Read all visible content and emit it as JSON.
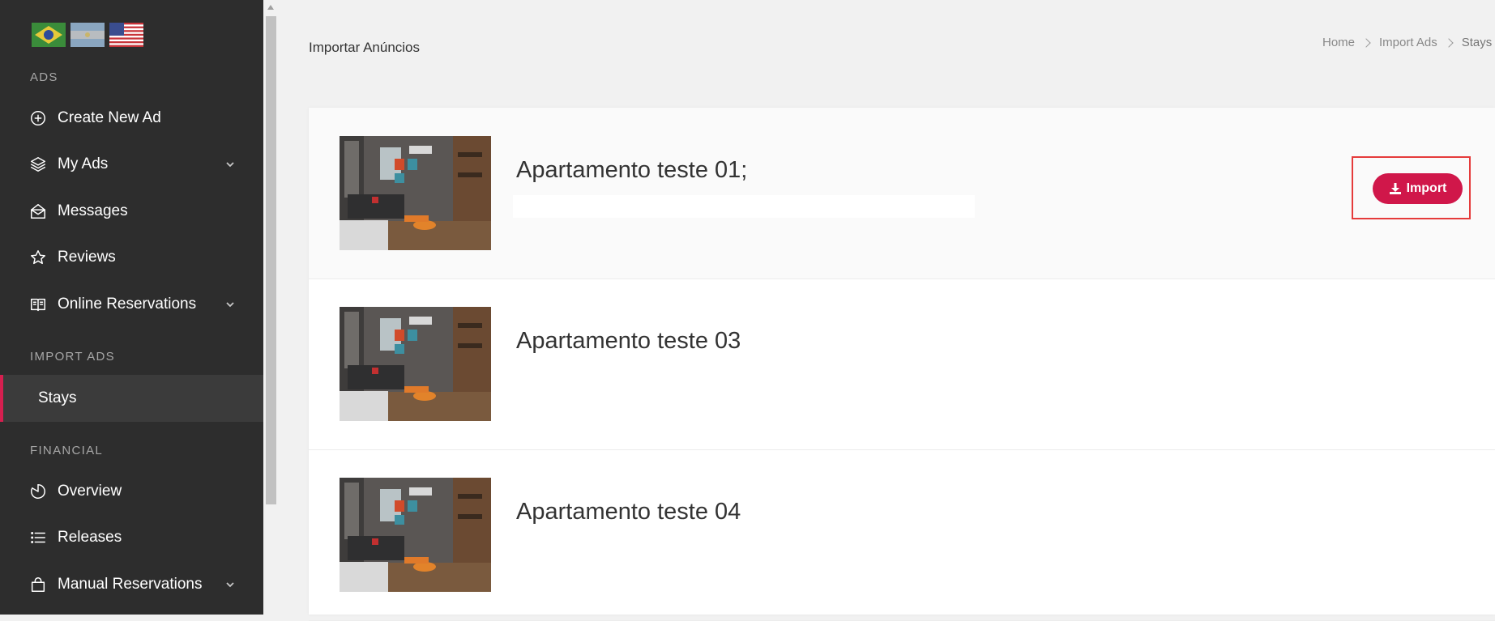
{
  "sidebar": {
    "flags": [
      "brazil-flag",
      "argentina-flag",
      "usa-flag"
    ],
    "sections": {
      "ads": "ADS",
      "import_ads": "IMPORT ADS",
      "financial": "FINANCIAL"
    },
    "items": {
      "create_new_ad": "Create New Ad",
      "my_ads": "My Ads",
      "messages": "Messages",
      "reviews": "Reviews",
      "online_reservations": "Online Reservations",
      "stays": "Stays",
      "overview": "Overview",
      "releases": "Releases",
      "manual_reservations": "Manual Reservations"
    }
  },
  "header": {
    "title": "Importar Anúncios",
    "breadcrumb": [
      "Home",
      "Import Ads",
      "Stays"
    ]
  },
  "listings": [
    {
      "title": "Apartamento teste 01;"
    },
    {
      "title": "Apartamento teste 03"
    },
    {
      "title": "Apartamento teste 04"
    }
  ],
  "actions": {
    "import_label": "Import"
  },
  "colors": {
    "accent": "#d0174a",
    "sidebar_bg": "#2d2d2d",
    "highlight_border": "#e53b3b"
  }
}
